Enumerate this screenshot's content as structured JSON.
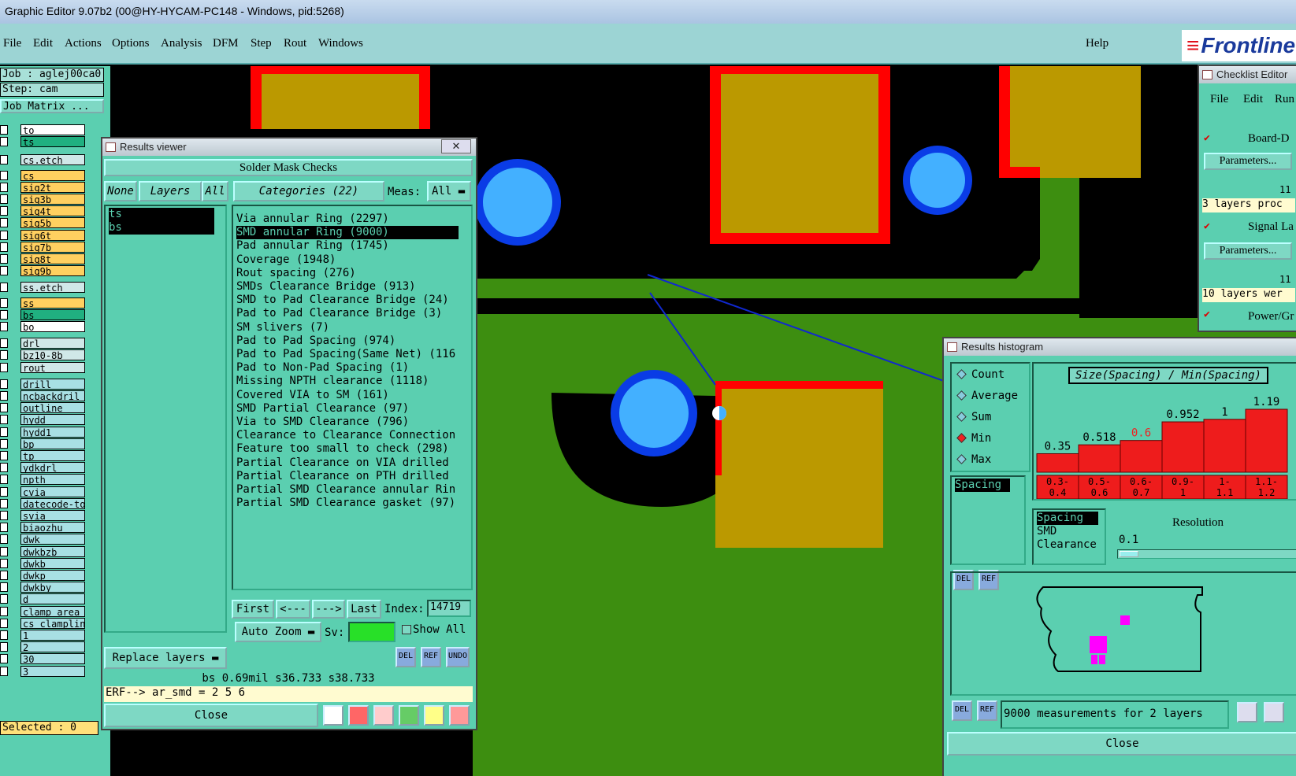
{
  "window": {
    "title": "Graphic Editor 9.07b2 (00@HY-HYCAM-PC148 - Windows, pid:5268)"
  },
  "menubar": {
    "items": [
      "File",
      "Edit",
      "Actions",
      "Options",
      "Analysis",
      "DFM",
      "Step",
      "Rout",
      "Windows"
    ],
    "help": "Help",
    "logo": "Frontline"
  },
  "left": {
    "job": "Job : aglej00ca0",
    "step": "Step: cam",
    "matrix": "Job Matrix ...",
    "layers": [
      "to",
      "ts",
      "cs.etch",
      "cs",
      "sig2t",
      "sig3b",
      "sig4t",
      "sig5b",
      "sig6t",
      "sig7b",
      "sig8t",
      "sig9b",
      "ss.etch",
      "ss",
      "bs",
      "bo",
      "drl",
      "bz10-8b",
      "rout",
      "drill",
      "ncbackdril",
      "outline",
      "hydd",
      "hydd1",
      "bp",
      "tp",
      "ydkdrl",
      "npth",
      "cvia",
      "datecode-to",
      "svia",
      "biaozhu",
      "dwk",
      "dwkbzb",
      "dwkb",
      "dwkp",
      "dwkby",
      "d",
      "clamp_area",
      "cs_clampline",
      "1",
      "2",
      "30",
      "3"
    ],
    "selected": "Selected : 0"
  },
  "results": {
    "title": "Results viewer",
    "header": "Solder Mask Checks",
    "none": "None",
    "layers_btn": "Layers",
    "all": "All",
    "categories": "Categories (22)",
    "meas_label": "Meas:",
    "meas_value": "All",
    "layer_list": [
      "ts",
      "bs"
    ],
    "items": [
      "Via annular Ring (2297)",
      "SMD annular Ring (9000)",
      "Pad annular Ring (1745)",
      "Coverage (1948)",
      "Rout spacing (276)",
      "SMDs Clearance Bridge (913)",
      "SMD to Pad Clearance Bridge (24)",
      "Pad to Pad Clearance Bridge (3)",
      "SM slivers (7)",
      "Pad to Pad Spacing (974)",
      "Pad to Pad Spacing(Same Net) (116",
      "Pad to Non-Pad Spacing (1)",
      "Missing NPTH clearance (1118)",
      "Covered VIA to SM (161)",
      "SMD Partial Clearance (97)",
      "Via to SMD Clearance (796)",
      "Clearance to Clearance Connection",
      "Feature too small to check (298)",
      "Partial Clearance on VIA drilled",
      "Partial Clearance on PTH drilled",
      "Partial SMD Clearance annular Rin",
      "Partial SMD Clearance gasket (97)"
    ],
    "first": "First",
    "prev": "<---",
    "next": "--->",
    "last": "Last",
    "index_label": "Index:",
    "index_value": "14719",
    "autozoom": "Auto Zoom",
    "sv": "Sv:",
    "showall": "Show All",
    "replace": "Replace layers",
    "status": "bs 0.69mil    s36.733    s38.733",
    "erf": "ERF--> ar_smd = 2 5 6",
    "close": "Close",
    "del": "DEL",
    "ref": "REF",
    "undo": "UNDO"
  },
  "checklist": {
    "title": "Checklist Editor",
    "menu": [
      "File",
      "Edit",
      "Run"
    ],
    "item1": "Board-D",
    "params": "Parameters...",
    "msg1": "3 layers proc",
    "item2": "Signal La",
    "msg2": "10 layers wer",
    "item3": "Power/Gr",
    "num": "11"
  },
  "histogram": {
    "title": "Results histogram",
    "options": [
      "Count",
      "Average",
      "Sum",
      "Min",
      "Max"
    ],
    "selected": "Min",
    "header": "Size(Spacing) / Min(Spacing)",
    "param_list": [
      "Spacing"
    ],
    "measure_list": [
      "Spacing",
      "SMD",
      "Clearance"
    ],
    "resolution_label": "Resolution",
    "resolution": "0.1",
    "footer": "9000 measurements for 2 layers",
    "close": "Close"
  },
  "chart_data": {
    "type": "bar",
    "title": "Size(Spacing) / Min(Spacing)",
    "categories": [
      "0.3-0.4",
      "0.5-0.6",
      "0.6-0.7",
      "0.9-1",
      "1-1.1",
      "1.1-1.2"
    ],
    "values": [
      0.35,
      0.518,
      0.6,
      0.952,
      1,
      1.19
    ],
    "value_labels": [
      "0.35",
      "0.518",
      "0.6",
      "0.952",
      "1",
      "1.19"
    ],
    "highlight": "0.6",
    "color": "#ee1c1c"
  }
}
